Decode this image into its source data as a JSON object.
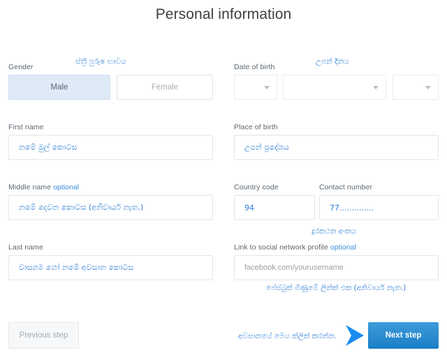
{
  "page": {
    "title": "Personal information"
  },
  "colors": {
    "accent_blue": "#2f7fd6",
    "annotation_blue": "#2f7fd6",
    "selected_fill": "#dfeaf7",
    "next_button": "#1a7fc6",
    "arrow": "#1a8cf0",
    "label_grey": "#5b6670",
    "border": "#e2e5e8"
  },
  "form": {
    "gender": {
      "label": "Gender",
      "annotation": "ස්ත්‍රී පුරුෂ භාවය",
      "options": [
        {
          "label": "Male",
          "selected": true
        },
        {
          "label": "Female",
          "selected": false
        }
      ]
    },
    "date_of_birth": {
      "label": "Date of birth",
      "annotation": "උපන් දිනය",
      "selects": [
        {
          "name": "day",
          "value": ""
        },
        {
          "name": "month",
          "value": ""
        },
        {
          "name": "year",
          "value": ""
        }
      ]
    },
    "first_name": {
      "label": "First name",
      "value": "නමේ මුල් කොටස"
    },
    "place_of_birth": {
      "label": "Place of birth",
      "value": "උපන් ප්‍රදේශය"
    },
    "middle_name": {
      "label": "Middle name",
      "optional_tag": "optional",
      "value": "නමේ දෙවන කොටස (අනිවාර්ය නැත.)"
    },
    "country_code": {
      "label": "Country code",
      "value": "94"
    },
    "contact_number": {
      "label": "Contact number",
      "value": "77..............",
      "annotation": "දුරකථන අංකය"
    },
    "last_name": {
      "label": "Last name",
      "value": "වාසගම හෝ නමේ අවසාන කොටස"
    },
    "social_profile": {
      "label": "Link to social network profile",
      "optional_tag": "optional",
      "placeholder": "facebook.com/yourusername",
      "annotation": "ෆේස්බුක් ගිණුමේ ලින්ක් එක (අනිවාර්ය නැත.)"
    }
  },
  "footer": {
    "previous_label": "Previous step",
    "next_label": "Next step",
    "annotation": "අවසානයේ මෙය ක්ලික් කරන්න.",
    "arrow_icon": "arrow-right-icon"
  }
}
